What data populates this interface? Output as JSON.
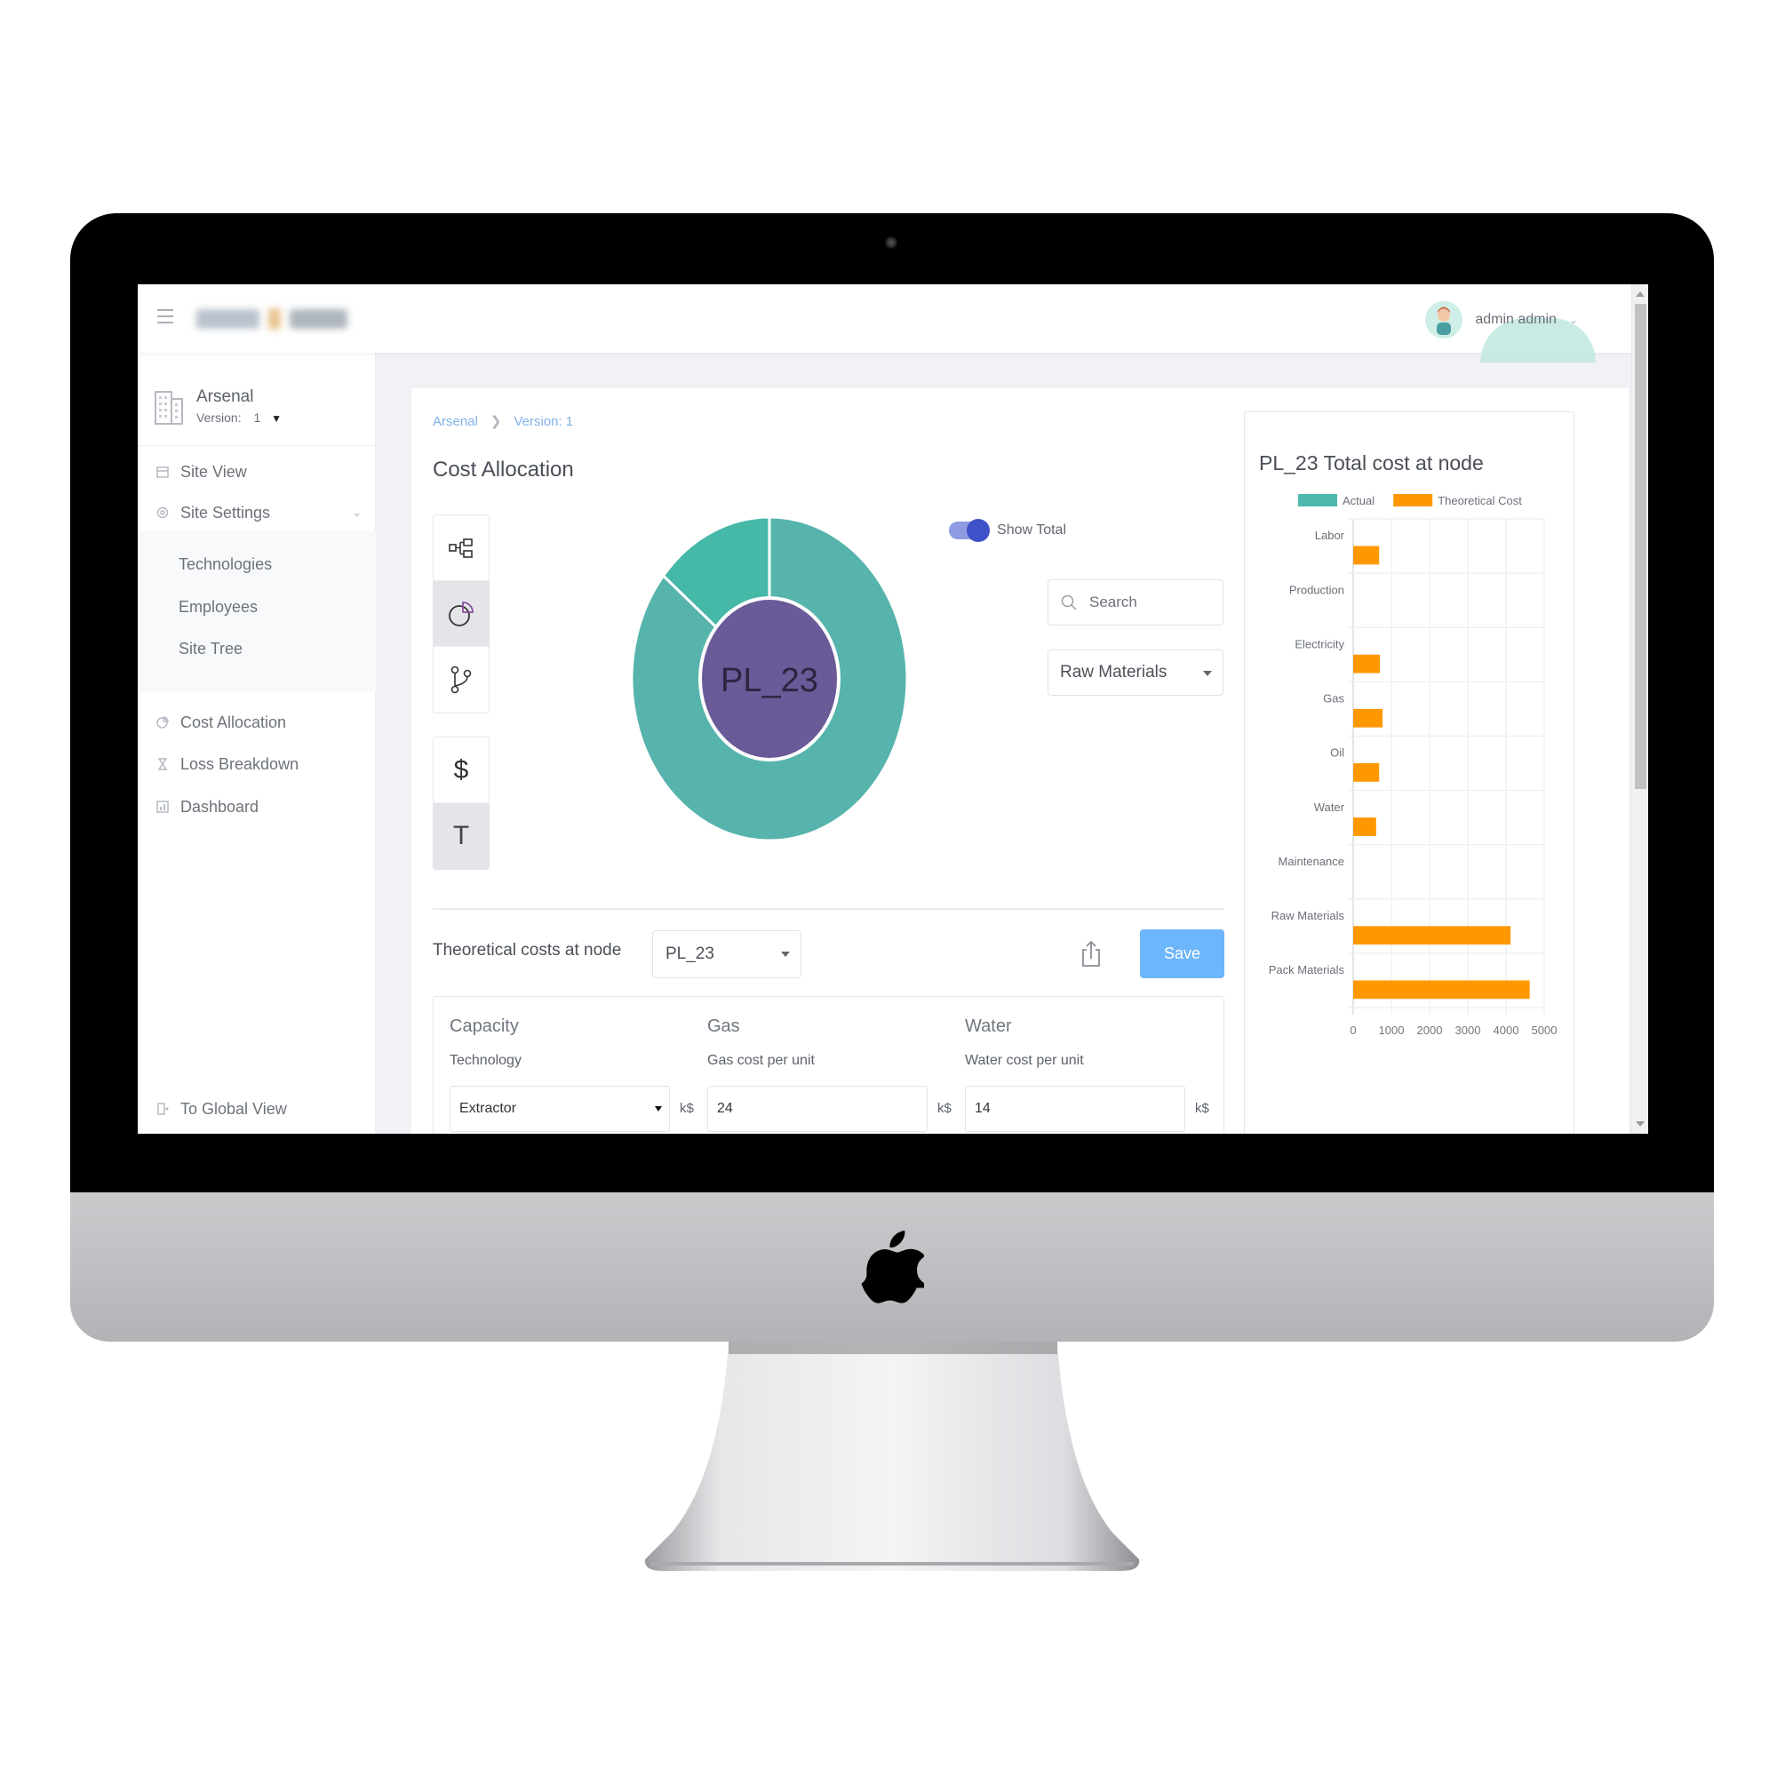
{
  "header": {
    "menu_icon": "hamburger-icon",
    "brand": "blurred-logo",
    "user_name": "admin admin"
  },
  "sidebar": {
    "site_name": "Arsenal",
    "version_label": "Version:",
    "version_value": "1",
    "items": [
      {
        "label": "Site View",
        "icon": "calendar-icon"
      },
      {
        "label": "Site Settings",
        "icon": "gear-icon",
        "expanded": true
      },
      {
        "label": "Cost Allocation",
        "icon": "pie-chart-icon"
      },
      {
        "label": "Loss Breakdown",
        "icon": "hourglass-icon"
      },
      {
        "label": "Dashboard",
        "icon": "dashboard-icon"
      }
    ],
    "sub_items": [
      {
        "label": "Technologies"
      },
      {
        "label": "Employees"
      },
      {
        "label": "Site Tree"
      }
    ],
    "footer_link": "To Global View"
  },
  "main": {
    "breadcrumb": [
      "Arsenal",
      "Version: 1"
    ],
    "title": "Cost Allocation",
    "view_tools": [
      {
        "icon": "hierarchy-icon",
        "active": false
      },
      {
        "icon": "pie-chart-icon",
        "active": true
      },
      {
        "icon": "branch-icon",
        "active": false
      }
    ],
    "unit_tools": [
      {
        "glyph": "$",
        "icon": "dollar-icon",
        "active": false
      },
      {
        "glyph": "T",
        "icon": "tonnage-icon",
        "active": true
      }
    ],
    "donut": {
      "center_label": "PL_23",
      "center_color": "#6a5a98",
      "segments": [
        {
          "fraction": 0.86,
          "color": "#56b4ac"
        },
        {
          "fraction": 0.14,
          "color": "#45b8a8"
        }
      ]
    },
    "show_total_label": "Show Total",
    "show_total_on": true,
    "search_placeholder": "Search",
    "category_select": "Raw Materials",
    "theoretical_label": "Theoretical costs at node",
    "node_select": "PL_23",
    "save_label": "Save",
    "form": {
      "columns": [
        {
          "heading": "Capacity",
          "field_label": "Technology",
          "value": "Extractor",
          "unit": "k$"
        },
        {
          "heading": "Gas",
          "field_label": "Gas cost per unit",
          "value": "24",
          "unit": "k$"
        },
        {
          "heading": "Water",
          "field_label": "Water cost per unit",
          "value": "14",
          "unit": "k$"
        }
      ]
    }
  },
  "chart_data": {
    "type": "bar",
    "orientation": "horizontal",
    "title": "PL_23 Total cost at node",
    "categories": [
      "Labor",
      "Production",
      "Electricity",
      "Gas",
      "Oil",
      "Water",
      "Maintenance",
      "Raw Materials",
      "Pack Materials"
    ],
    "series": [
      {
        "name": "Actual",
        "color": "#4fb8ae",
        "values": [
          0,
          0,
          0,
          0,
          0,
          0,
          0,
          0,
          0
        ]
      },
      {
        "name": "Theoretical Cost",
        "color": "#ff9800",
        "values": [
          680,
          0,
          700,
          770,
          680,
          600,
          0,
          4120,
          4620
        ]
      }
    ],
    "xticks": [
      0,
      1000,
      2000,
      3000,
      4000,
      5000
    ],
    "xlim": [
      0,
      5000
    ],
    "grid": true,
    "legend": "top"
  }
}
